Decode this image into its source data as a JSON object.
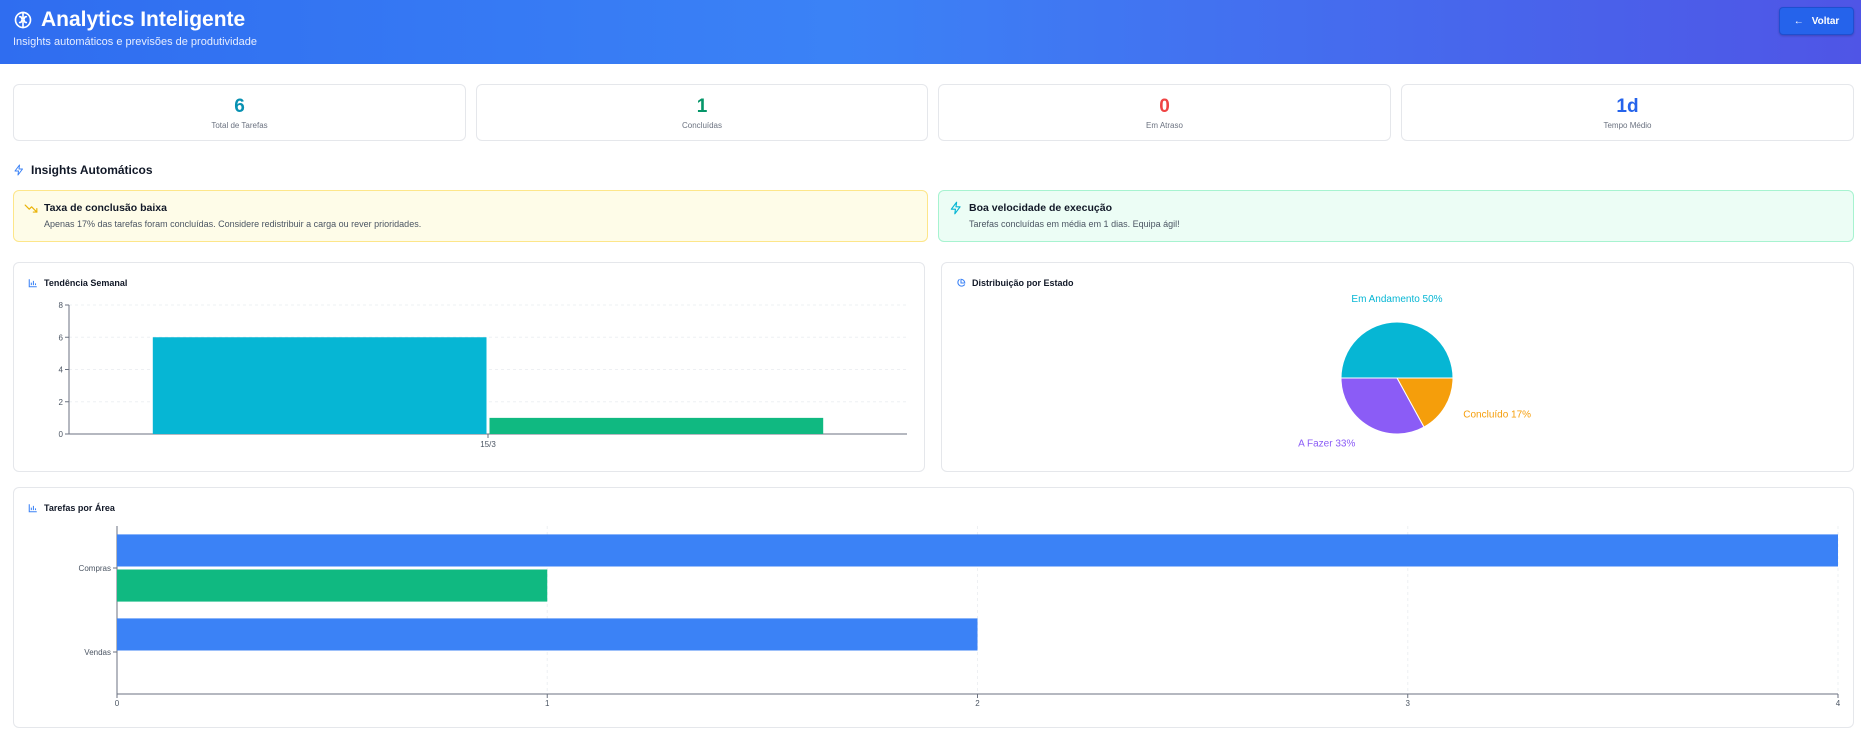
{
  "header": {
    "title": "Analytics Inteligente",
    "subtitle": "Insights automáticos e previsões de produtividade",
    "back_label": "Voltar"
  },
  "stats": [
    {
      "value": "6",
      "label": "Total de Tarefas",
      "color": "#0891b2"
    },
    {
      "value": "1",
      "label": "Concluídas",
      "color": "#059669"
    },
    {
      "value": "0",
      "label": "Em Atraso",
      "color": "#ef4444"
    },
    {
      "value": "1d",
      "label": "Tempo Médio",
      "color": "#2563eb"
    }
  ],
  "insights_section": {
    "title": "Insights Automáticos"
  },
  "insights": [
    {
      "title": "Taxa de conclusão baixa",
      "text": "Apenas 17% das tarefas foram concluídas. Considere redistribuir a carga ou rever prioridades.",
      "bg": "#fefce8",
      "border": "#fde68a",
      "icon": "trending-down-icon"
    },
    {
      "title": "Boa velocidade de execução",
      "text": "Tarefas concluídas em média em 1 dias. Equipa ágil!",
      "bg": "#ecfdf5",
      "border": "#a7f3d0",
      "icon": "zap-icon"
    }
  ],
  "cards": {
    "weekly": "Tendência Semanal",
    "distribution": "Distribuição por Estado",
    "areas": "Tarefas por Área"
  },
  "chart_data": [
    {
      "type": "bar",
      "categories": [
        "15/3"
      ],
      "series": [
        {
          "values": [
            6
          ],
          "color": "#06b6d4"
        },
        {
          "values": [
            1
          ],
          "color": "#10b981"
        }
      ],
      "ylim": [
        0,
        8
      ],
      "yticks": [
        0,
        2,
        4,
        6,
        8
      ]
    },
    {
      "type": "pie",
      "slices": [
        {
          "label": "Em Andamento 50%",
          "value": 50,
          "color": "#06b6d4"
        },
        {
          "label": "Concluído 17%",
          "value": 17,
          "color": "#f59e0b"
        },
        {
          "label": "A Fazer 33%",
          "value": 33,
          "color": "#8b5cf6"
        }
      ]
    },
    {
      "type": "bar",
      "orientation": "horizontal",
      "categories": [
        "Compras",
        "Vendas"
      ],
      "series": [
        {
          "values": [
            4,
            2
          ],
          "color": "#3b82f6"
        },
        {
          "values": [
            1,
            0
          ],
          "color": "#10b981"
        }
      ],
      "xlim": [
        0,
        4
      ],
      "xticks": [
        0,
        1,
        2,
        3,
        4
      ]
    }
  ]
}
